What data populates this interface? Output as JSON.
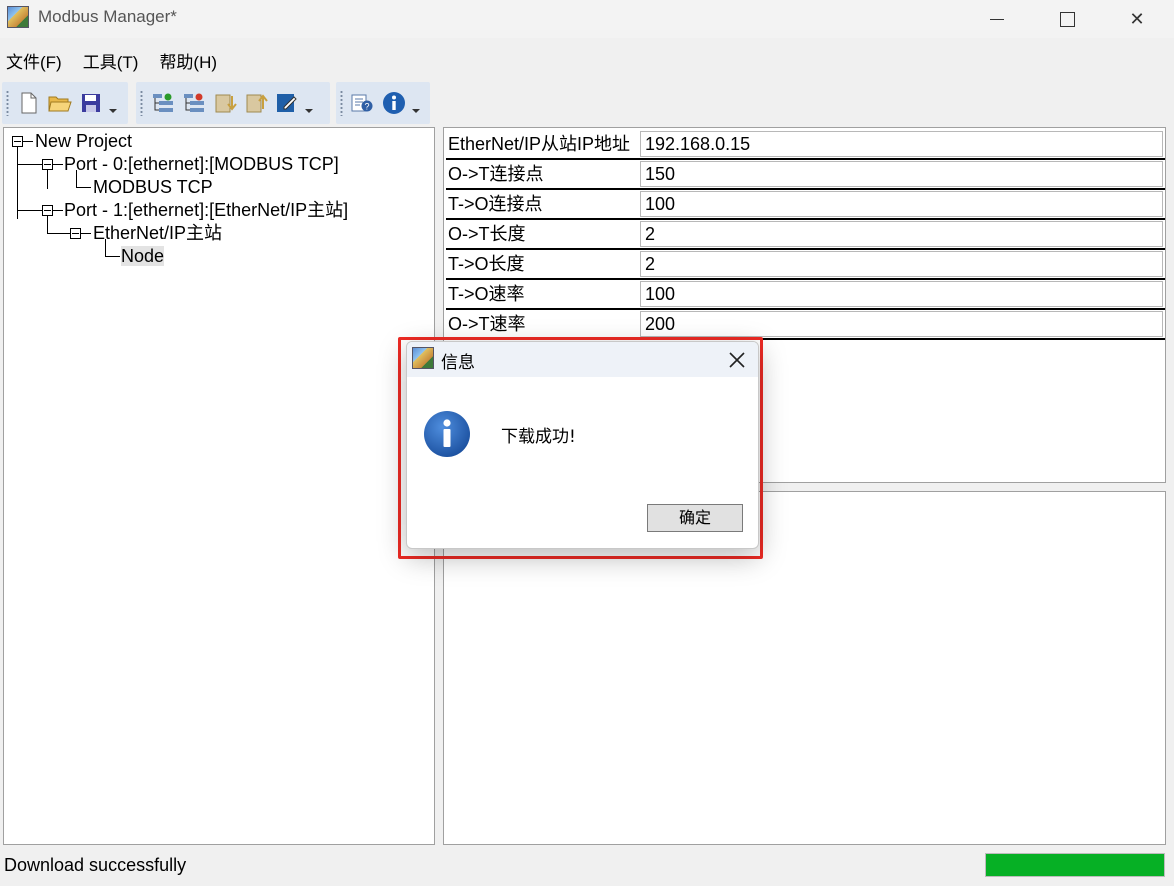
{
  "window": {
    "title": "Modbus Manager*",
    "close_glyph": "✕"
  },
  "menu": [
    {
      "label": "文件(F)"
    },
    {
      "label": "工具(T)"
    },
    {
      "label": "帮助(H)"
    }
  ],
  "toolbar": {
    "groups": [
      [
        "new-file-icon",
        "open-folder-icon",
        "save-icon"
      ],
      [
        "add-port-icon",
        "remove-port-icon",
        "download-icon",
        "upload-icon",
        "edit-notepad-icon"
      ],
      [
        "help-search-icon",
        "info-icon"
      ]
    ]
  },
  "tree": {
    "root": "New Project",
    "port0": "Port - 0:[ethernet]:[MODBUS TCP]",
    "port0_child": "MODBUS TCP",
    "port1": "Port - 1:[ethernet]:[EtherNet/IP主站]",
    "port1_child": "EtherNet/IP主站",
    "node": "Node"
  },
  "properties": [
    {
      "label": "EtherNet/IP从站IP地址",
      "value": "192.168.0.15"
    },
    {
      "label": "O->T连接点",
      "value": "150"
    },
    {
      "label": "T->O连接点",
      "value": "100"
    },
    {
      "label": "O->T长度",
      "value": "2"
    },
    {
      "label": "T->O长度",
      "value": "2"
    },
    {
      "label": "T->O速率",
      "value": "100"
    },
    {
      "label": "O->T速率",
      "value": "200"
    }
  ],
  "status": {
    "text": "Download successfully",
    "progress": 1.0,
    "progress_color": "#06b025"
  },
  "dialog": {
    "title": "信息",
    "message": "下载成功!",
    "ok_label": "确定",
    "highlight_color": "#ee2a24"
  }
}
